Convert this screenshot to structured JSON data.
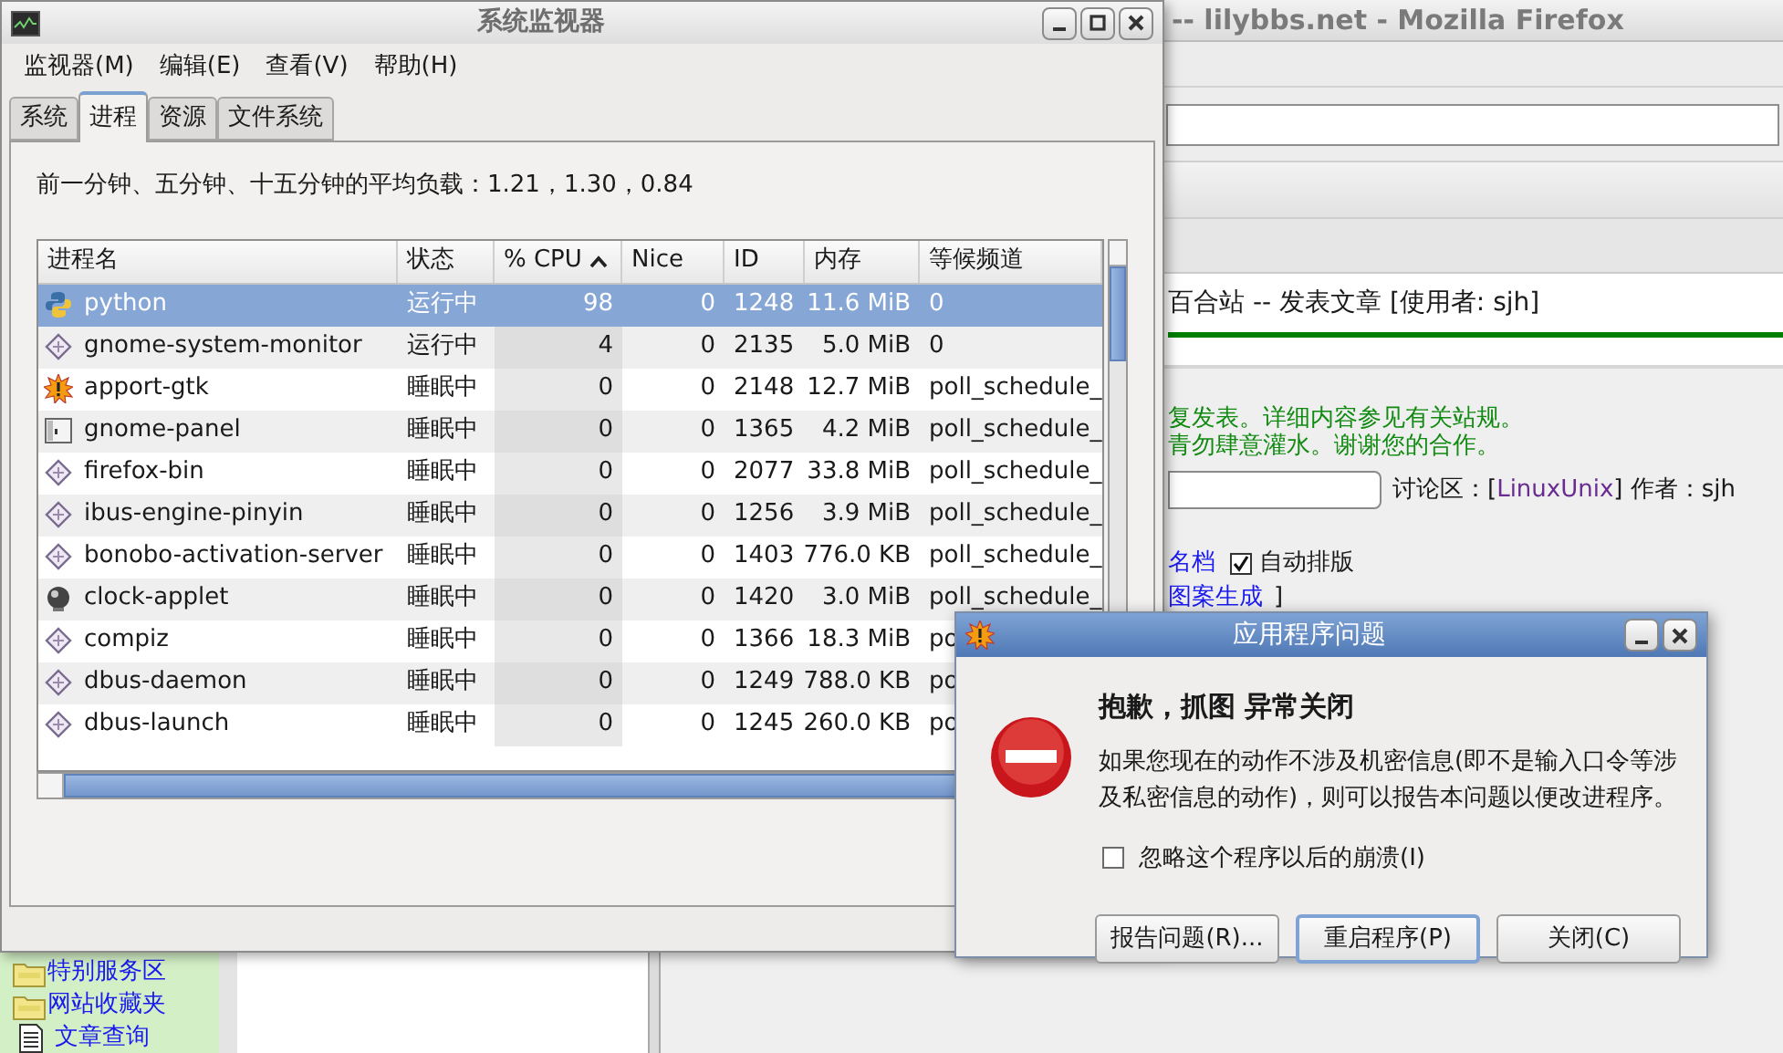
{
  "browser": {
    "title": "-- lilybbs.net - Mozilla Firefox",
    "sidebar_items": [
      {
        "label": "特别服务区",
        "kind": "folder"
      },
      {
        "label": "网站收藏夹",
        "kind": "folder"
      },
      {
        "label": "文章查询",
        "kind": "document"
      }
    ],
    "page_header": "百合站 -- 发表文章 [使用者: sjh]",
    "notice_lines": [
      "复发表。详细内容参见有关站规。",
      "青勿肆意灌水。谢谢您的合作。"
    ],
    "board_prefix": "讨论区：[",
    "board_link": "LinuxUnix",
    "board_suffix": "] 作者：sjh",
    "signature_link": "名档",
    "auto_format": {
      "label": "自动排版",
      "checked": true
    },
    "pattern_link": "图案生成",
    "pattern_suffix": "]"
  },
  "monitor": {
    "title": "系统监视器",
    "menus": [
      "监视器(M)",
      "编辑(E)",
      "查看(V)",
      "帮助(H)"
    ],
    "tabs": [
      {
        "label": "系统",
        "selected": false
      },
      {
        "label": "进程",
        "selected": true
      },
      {
        "label": "资源",
        "selected": false
      },
      {
        "label": "文件系统",
        "selected": false
      }
    ],
    "load_text": "前一分钟、五分钟、十五分钟的平均负载：1.21，1.30，0.84",
    "columns": [
      {
        "label": "进程名",
        "sorted": false
      },
      {
        "label": "状态",
        "sorted": false
      },
      {
        "label": "% CPU",
        "sorted": true
      },
      {
        "label": "Nice",
        "sorted": false
      },
      {
        "label": "ID",
        "sorted": false
      },
      {
        "label": "内存",
        "sorted": false
      },
      {
        "label": "等候频道",
        "sorted": false
      }
    ],
    "processes": [
      {
        "name": "python",
        "kind": "python",
        "status": "运行中",
        "cpu": "98",
        "nice": "0",
        "id": "1248",
        "memory": "11.6 MiB",
        "wait": "0",
        "selected": true
      },
      {
        "name": "gnome-system-monitor",
        "kind": "diamond",
        "status": "运行中",
        "cpu": "4",
        "nice": "0",
        "id": "2135",
        "memory": "5.0 MiB",
        "wait": "0",
        "selected": false
      },
      {
        "name": "apport-gtk",
        "kind": "burst",
        "status": "睡眠中",
        "cpu": "0",
        "nice": "0",
        "id": "2148",
        "memory": "12.7 MiB",
        "wait": "poll_schedule_",
        "selected": false
      },
      {
        "name": "gnome-panel",
        "kind": "panel",
        "status": "睡眠中",
        "cpu": "0",
        "nice": "0",
        "id": "1365",
        "memory": "4.2 MiB",
        "wait": "poll_schedule_",
        "selected": false
      },
      {
        "name": "firefox-bin",
        "kind": "diamond",
        "status": "睡眠中",
        "cpu": "0",
        "nice": "0",
        "id": "2077",
        "memory": "33.8 MiB",
        "wait": "poll_schedule_",
        "selected": false
      },
      {
        "name": "ibus-engine-pinyin",
        "kind": "diamond",
        "status": "睡眠中",
        "cpu": "0",
        "nice": "0",
        "id": "1256",
        "memory": "3.9 MiB",
        "wait": "poll_schedule_",
        "selected": false
      },
      {
        "name": "bonobo-activation-server",
        "kind": "diamond",
        "status": "睡眠中",
        "cpu": "0",
        "nice": "0",
        "id": "1403",
        "memory": "776.0 KB",
        "wait": "poll_schedule_",
        "selected": false
      },
      {
        "name": "clock-applet",
        "kind": "ball",
        "status": "睡眠中",
        "cpu": "0",
        "nice": "0",
        "id": "1420",
        "memory": "3.0 MiB",
        "wait": "poll_schedule_",
        "selected": false
      },
      {
        "name": "compiz",
        "kind": "diamond",
        "status": "睡眠中",
        "cpu": "0",
        "nice": "0",
        "id": "1366",
        "memory": "18.3 MiB",
        "wait": "po",
        "selected": false
      },
      {
        "name": "dbus-daemon",
        "kind": "diamond",
        "status": "睡眠中",
        "cpu": "0",
        "nice": "0",
        "id": "1249",
        "memory": "788.0 KB",
        "wait": "po",
        "selected": false
      },
      {
        "name": "dbus-launch",
        "kind": "diamond",
        "status": "睡眠中",
        "cpu": "0",
        "nice": "0",
        "id": "1245",
        "memory": "260.0 KB",
        "wait": "po",
        "selected": false
      }
    ]
  },
  "dialog": {
    "title": "应用程序问题",
    "heading": "抱歉，抓图 异常关闭",
    "message": "如果您现在的动作不涉及机密信息(即不是输入口令等涉及私密信息的动作)，则可以报告本问题以便改进程序。",
    "ignore_checkbox": {
      "label": "忽略这个程序以后的崩溃(I)",
      "checked": false
    },
    "buttons": [
      {
        "label": "报告问题(R)...",
        "focused": false
      },
      {
        "label": "重启程序(P)",
        "focused": true
      },
      {
        "label": "关闭(C)",
        "focused": false
      }
    ]
  }
}
